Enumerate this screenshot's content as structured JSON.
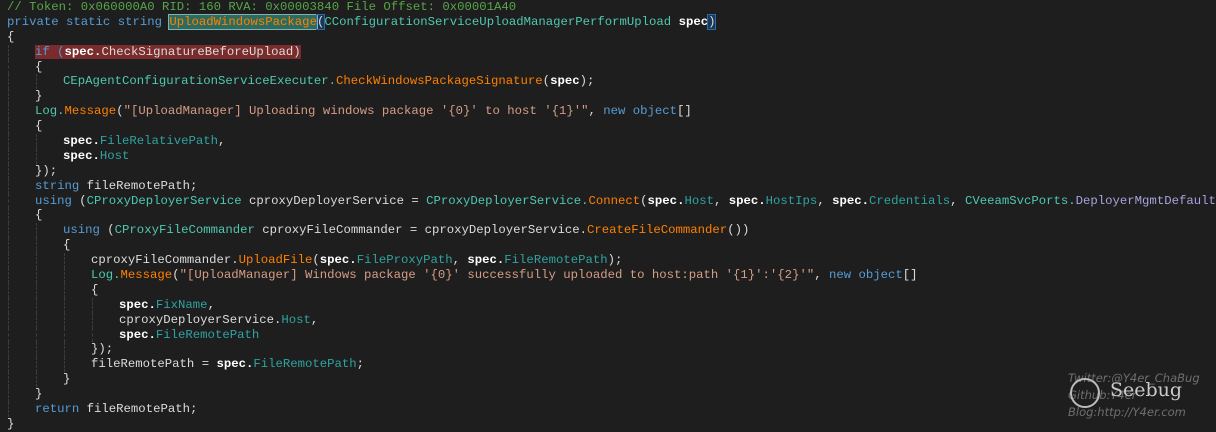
{
  "lines": [
    {
      "indent": 0,
      "tokens": [
        [
          "// Token: 0x060000A0 RID: 160 RVA: 0x00003840 File Offset: 0x00001A40",
          "cm"
        ]
      ]
    },
    {
      "indent": 0,
      "tokens": [
        [
          "private static string ",
          "kw"
        ],
        [
          "UploadWindowsPackage",
          "me hl"
        ],
        [
          "(",
          "br"
        ],
        [
          "CConfigurationServiceUploadManagerPerformUpload ",
          "ty"
        ],
        [
          "spec",
          "pa"
        ],
        [
          ")",
          "br"
        ]
      ]
    },
    {
      "indent": 0,
      "tokens": [
        [
          "{",
          "id"
        ]
      ]
    },
    {
      "indent": 1,
      "tokens": [
        [
          "if (",
          "kw bp"
        ],
        [
          "spec.",
          "pa bp"
        ],
        [
          "CheckSignatureBeforeUpload)",
          "id bp"
        ]
      ]
    },
    {
      "indent": 1,
      "tokens": [
        [
          "{",
          "id"
        ]
      ]
    },
    {
      "indent": 2,
      "tokens": [
        [
          "CEpAgentConfigurationServiceExecuter.",
          "ty"
        ],
        [
          "CheckWindowsPackageSignature",
          "me"
        ],
        [
          "(",
          "id"
        ],
        [
          "spec",
          "pa"
        ],
        [
          ");",
          "id"
        ]
      ]
    },
    {
      "indent": 1,
      "tokens": [
        [
          "}",
          "id"
        ]
      ]
    },
    {
      "indent": 1,
      "tokens": [
        [
          "Log.",
          "ty"
        ],
        [
          "Message",
          "me"
        ],
        [
          "(",
          "id"
        ],
        [
          "\"[UploadManager] Uploading windows package '{0}' to host '{1}'\"",
          "st"
        ],
        [
          ", ",
          "id"
        ],
        [
          "new object",
          "kw"
        ],
        [
          "[]",
          "id"
        ]
      ]
    },
    {
      "indent": 1,
      "tokens": [
        [
          "{",
          "id"
        ]
      ]
    },
    {
      "indent": 2,
      "tokens": [
        [
          "spec.",
          "pa"
        ],
        [
          "FileRelativePath",
          "pr"
        ],
        [
          ",",
          "id"
        ]
      ]
    },
    {
      "indent": 2,
      "tokens": [
        [
          "spec.",
          "pa"
        ],
        [
          "Host",
          "pr"
        ]
      ]
    },
    {
      "indent": 1,
      "tokens": [
        [
          "});",
          "id"
        ]
      ]
    },
    {
      "indent": 1,
      "tokens": [
        [
          "string ",
          "kw"
        ],
        [
          "fileRemotePath;",
          "id"
        ]
      ]
    },
    {
      "indent": 1,
      "tokens": [
        [
          "using ",
          "kw"
        ],
        [
          "(",
          "id"
        ],
        [
          "CProxyDeployerService ",
          "ty"
        ],
        [
          "cproxyDeployerService = ",
          "id"
        ],
        [
          "CProxyDeployerService.",
          "ty"
        ],
        [
          "Connect",
          "me"
        ],
        [
          "(",
          "id"
        ],
        [
          "spec.",
          "pa"
        ],
        [
          "Host",
          "pr"
        ],
        [
          ", ",
          "id"
        ],
        [
          "spec.",
          "pa"
        ],
        [
          "HostIps",
          "pr"
        ],
        [
          ", ",
          "id"
        ],
        [
          "spec.",
          "pa"
        ],
        [
          "Credentials",
          "pr"
        ],
        [
          ", ",
          "id"
        ],
        [
          "CVeeamSvcPorts.",
          "ty"
        ],
        [
          "DeployerMgmtDefaultPort",
          "en"
        ],
        [
          "))",
          "id"
        ]
      ]
    },
    {
      "indent": 1,
      "tokens": [
        [
          "{",
          "id"
        ]
      ]
    },
    {
      "indent": 2,
      "tokens": [
        [
          "using ",
          "kw"
        ],
        [
          "(",
          "id"
        ],
        [
          "CProxyFileCommander ",
          "ty"
        ],
        [
          "cproxyFileCommander = cproxyDeployerService.",
          "id"
        ],
        [
          "CreateFileCommander",
          "me"
        ],
        [
          "())",
          "id"
        ]
      ]
    },
    {
      "indent": 2,
      "tokens": [
        [
          "{",
          "id"
        ]
      ]
    },
    {
      "indent": 3,
      "tokens": [
        [
          "cproxyFileCommander.",
          "id"
        ],
        [
          "UploadFile",
          "me"
        ],
        [
          "(",
          "id"
        ],
        [
          "spec.",
          "pa"
        ],
        [
          "FileProxyPath",
          "pr"
        ],
        [
          ", ",
          "id"
        ],
        [
          "spec.",
          "pa"
        ],
        [
          "FileRemotePath",
          "pr"
        ],
        [
          ");",
          "id"
        ]
      ]
    },
    {
      "indent": 3,
      "tokens": [
        [
          "Log.",
          "ty"
        ],
        [
          "Message",
          "me"
        ],
        [
          "(",
          "id"
        ],
        [
          "\"[UploadManager] Windows package '{0}' successfully uploaded to host:path '{1}':'{2}'\"",
          "st"
        ],
        [
          ", ",
          "id"
        ],
        [
          "new object",
          "kw"
        ],
        [
          "[]",
          "id"
        ]
      ]
    },
    {
      "indent": 3,
      "tokens": [
        [
          "{",
          "id"
        ]
      ]
    },
    {
      "indent": 4,
      "tokens": [
        [
          "spec.",
          "pa"
        ],
        [
          "FixName",
          "pr"
        ],
        [
          ",",
          "id"
        ]
      ]
    },
    {
      "indent": 4,
      "tokens": [
        [
          "cproxyDeployerService.",
          "id"
        ],
        [
          "Host",
          "pr"
        ],
        [
          ",",
          "id"
        ]
      ]
    },
    {
      "indent": 4,
      "tokens": [
        [
          "spec.",
          "pa"
        ],
        [
          "FileRemotePath",
          "pr"
        ]
      ]
    },
    {
      "indent": 3,
      "tokens": [
        [
          "});",
          "id"
        ]
      ]
    },
    {
      "indent": 3,
      "tokens": [
        [
          "fileRemotePath = ",
          "id"
        ],
        [
          "spec.",
          "pa"
        ],
        [
          "FileRemotePath",
          "pr"
        ],
        [
          ";",
          "id"
        ]
      ]
    },
    {
      "indent": 2,
      "tokens": [
        [
          "}",
          "id"
        ]
      ]
    },
    {
      "indent": 1,
      "tokens": [
        [
          "}",
          "id"
        ]
      ]
    },
    {
      "indent": 1,
      "tokens": [
        [
          "return ",
          "kw"
        ],
        [
          "fileRemotePath;",
          "id"
        ]
      ]
    },
    {
      "indent": 0,
      "tokens": [
        [
          "}",
          "id"
        ]
      ]
    }
  ],
  "watermark": {
    "twitter": "Twitter:@Y4er_ChaBug",
    "github": "Github:Y4er",
    "blog": "Blog:http://Y4er.com",
    "logo": "Seebug"
  }
}
